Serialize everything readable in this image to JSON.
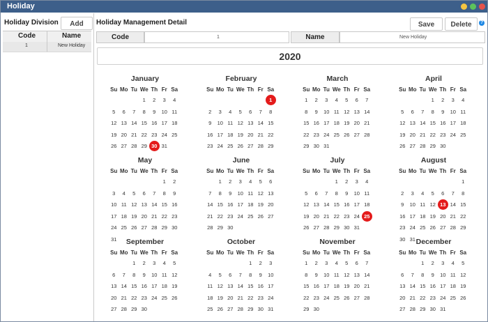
{
  "window": {
    "title": "Holiday"
  },
  "left": {
    "title": "Holiday Division",
    "add_label": "Add",
    "grid": {
      "headers": [
        "Code",
        "Name"
      ],
      "rows": [
        {
          "code": "1",
          "name": "New Holiday"
        }
      ]
    }
  },
  "right": {
    "title": "Holiday Management Detail",
    "save_label": "Save",
    "delete_label": "Delete",
    "help": "?",
    "code_label": "Code",
    "code_value": "1",
    "name_label": "Name",
    "name_value": "New Holiday",
    "year": "2020"
  },
  "calendar": {
    "weekdays": [
      "Su",
      "Mo",
      "Tu",
      "We",
      "Th",
      "Fr",
      "Sa"
    ],
    "months": [
      {
        "name": "January",
        "start": 3,
        "days": 31,
        "highlight": [
          30
        ]
      },
      {
        "name": "February",
        "start": 6,
        "days": 29,
        "highlight": [
          1
        ]
      },
      {
        "name": "March",
        "start": 0,
        "days": 31,
        "highlight": []
      },
      {
        "name": "April",
        "start": 3,
        "days": 30,
        "highlight": []
      },
      {
        "name": "May",
        "start": 5,
        "days": 31,
        "highlight": []
      },
      {
        "name": "June",
        "start": 1,
        "days": 30,
        "highlight": []
      },
      {
        "name": "July",
        "start": 3,
        "days": 31,
        "highlight": [
          25
        ]
      },
      {
        "name": "August",
        "start": 6,
        "days": 31,
        "highlight": [
          13
        ]
      },
      {
        "name": "September",
        "start": 2,
        "days": 30,
        "highlight": []
      },
      {
        "name": "October",
        "start": 4,
        "days": 31,
        "highlight": []
      },
      {
        "name": "November",
        "start": 0,
        "days": 30,
        "highlight": []
      },
      {
        "name": "December",
        "start": 2,
        "days": 31,
        "highlight": []
      }
    ],
    "highlight_color": "#e41b1b"
  },
  "colors": {
    "titlebar": "#3d5f8a",
    "min": "#f5c542",
    "max": "#5cc35c",
    "close": "#e5534b"
  }
}
